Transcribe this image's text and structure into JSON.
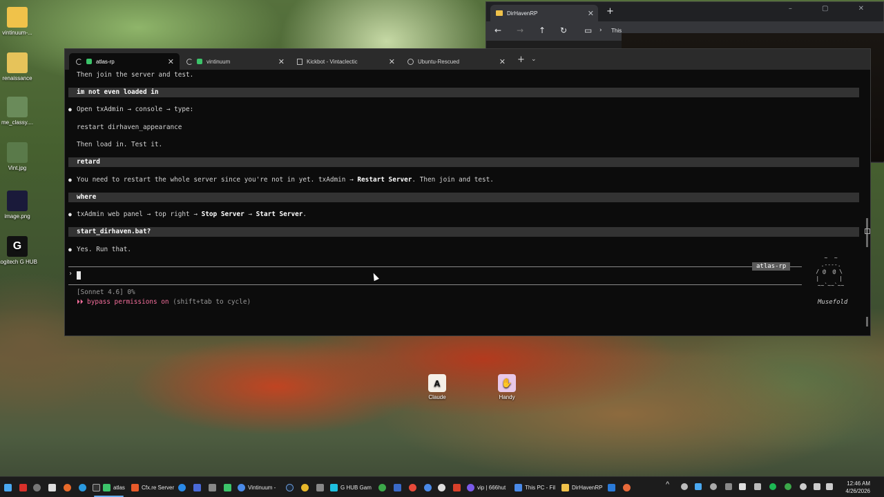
{
  "desktop": {
    "icons": [
      {
        "label": "vintinuum-...",
        "color": "#f0c24a"
      },
      {
        "label": "renaissance",
        "color": "#e6c35a"
      },
      {
        "label": "me_classy....",
        "color": "#6a8b5a"
      },
      {
        "label": "Vint.jpg",
        "color": "#5a7a4a"
      },
      {
        "label": "image.png",
        "color": "#1a1a3a"
      },
      {
        "label": "Logitech G HUB",
        "color": "#111111"
      }
    ],
    "mid_icons": [
      {
        "label": "Claude",
        "glyph": "A\\",
        "color": "#f5f0e8"
      },
      {
        "label": "Handy",
        "glyph": "✋",
        "color": "#e8c8e8"
      }
    ]
  },
  "chrome": {
    "tab_title": "DirHavenRP",
    "address_fragment": "This",
    "controls": [
      "–",
      "▢",
      "✕"
    ]
  },
  "terminal": {
    "tabs": [
      {
        "title": "atlas-rp",
        "active": true,
        "dot_color": "#3cc46a"
      },
      {
        "title": "vintinuum",
        "active": false,
        "dot_color": "#3cc46a"
      },
      {
        "title": "Kickbot - Vintaclectic",
        "active": false,
        "dot_color": ""
      },
      {
        "title": "Ubuntu-Rescued",
        "active": false,
        "dot_color": ""
      }
    ],
    "lines": {
      "l1": "Then join the server and test.",
      "u1": "im not even loaded in",
      "l2": "Open txAdmin → console → type:",
      "l3": "restart dirhaven_appearance",
      "l4": "Then load in. Test it.",
      "u2": "retard",
      "l5_a": "You need to restart the whole server since you're not in yet. txAdmin → ",
      "l5_b": "Restart Server",
      "l5_c": ". Then join and test.",
      "u3": "where",
      "l6_a": "txAdmin web panel → top right → ",
      "l6_b": "Stop Server",
      "l6_c": " → ",
      "l6_d": "Start Server",
      "l6_e": ".",
      "u4": "start_dirhaven.bat?",
      "l7": "Yes. Run that."
    },
    "badge": "atlas-rp",
    "prompt_symbol": "›",
    "status_model": "[Sonnet 4.6] 0%",
    "status_mode_arrows": "⏵⏵",
    "status_mode_label": "bypass permissions on",
    "status_mode_hint": "(shift+tab to cycle)",
    "mascot_art": " ~  ~\n .----.\n/ @  @ \\\n|      |\n ~~`~~`~~",
    "mascot_name": "Musefold"
  },
  "taskbar": {
    "items": [
      {
        "label": "atlas",
        "color": "#3cc46a"
      },
      {
        "label": "Cfx.re Server",
        "color": "#e85a2a"
      },
      {
        "label": "Vintinuum -",
        "color": "#4a8ae8"
      },
      {
        "label": "G HUB Gam",
        "color": "#1ec0e0"
      },
      {
        "label": "vip | 666hut",
        "color": "#7a5ae8"
      },
      {
        "label": "This PC - Fil",
        "color": "#f0c24a"
      },
      {
        "label": "DirHavenRP",
        "color": "#f0c24a"
      }
    ],
    "time": "12:46 AM",
    "date": "4/26/2026"
  }
}
